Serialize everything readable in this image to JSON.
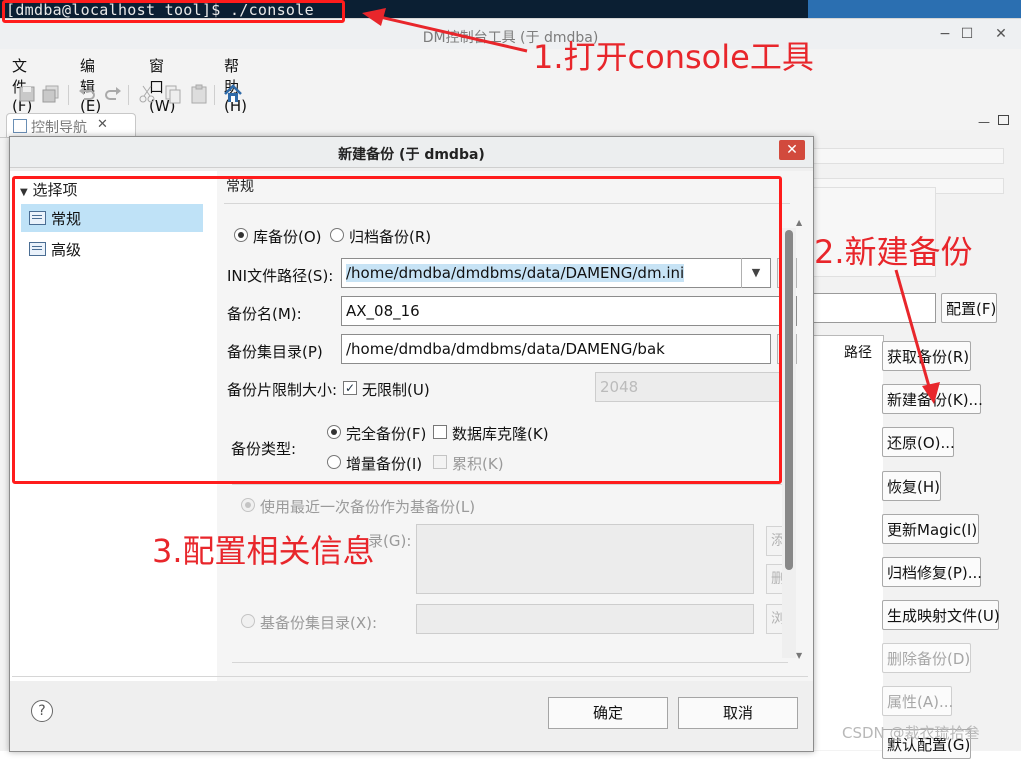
{
  "terminal": {
    "prompt": "[dmdba@localhost tool]$ ./console"
  },
  "window": {
    "title": "DM控制台工具 (于 dmdba)",
    "controls": {
      "minimize": "−",
      "maximize": "☐",
      "close": "✕"
    }
  },
  "menu": [
    "文件(F)",
    "编辑(E)",
    "窗口(W)",
    "帮助(H)"
  ],
  "toolbar_icons": [
    "save-icon",
    "save-all-icon",
    "undo-icon",
    "redo-icon",
    "cut-icon",
    "copy-icon",
    "paste-icon",
    "home-icon"
  ],
  "nav_tab": {
    "label": "控制导航",
    "close": "✕"
  },
  "right_panel": {
    "config_button": "配置(F)",
    "table_header": "路径",
    "buttons": [
      {
        "label": "获取备份(R)",
        "enabled": true
      },
      {
        "label": "新建备份(K)...",
        "enabled": true
      },
      {
        "label": "还原(O)...",
        "enabled": true
      },
      {
        "label": "恢复(H)",
        "enabled": true
      },
      {
        "label": "更新Magic(I)",
        "enabled": true
      },
      {
        "label": "归档修复(P)...",
        "enabled": true
      },
      {
        "label": "生成映射文件(U)",
        "enabled": true
      },
      {
        "label": "删除备份(D)",
        "enabled": false
      },
      {
        "label": "属性(A)...",
        "enabled": false
      },
      {
        "label": "默认配置(G)",
        "enabled": true
      }
    ]
  },
  "dialog": {
    "title": "新建备份 (于 dmdba)",
    "close": "✕",
    "options_header": "选择项",
    "options": [
      {
        "label": "常规",
        "selected": true
      },
      {
        "label": "高级",
        "selected": false
      }
    ],
    "group_label": "常规",
    "backup_kind": {
      "db_backup": "库备份(O)",
      "archive_backup": "归档备份(R)",
      "selected": "db_backup"
    },
    "ini_path": {
      "label": "INI文件路径(S):",
      "value": "/home/dmdba/dmdbms/data/DAMENG/dm.ini",
      "browse": "浏"
    },
    "backup_name": {
      "label": "备份名(M):",
      "value": "AX_08_16"
    },
    "backup_dir": {
      "label": "备份集目录(P)",
      "value": "/home/dmdba/dmdbms/data/DAMENG/bak",
      "browse": "浏"
    },
    "piece_limit": {
      "label": "备份片限制大小:",
      "unlimited_label": "无限制(U)",
      "unlimited": true,
      "value": "2048"
    },
    "backup_type": {
      "label": "备份类型:",
      "full": "完全备份(F)",
      "incremental": "增量备份(I)",
      "clone": "数据库克隆(K)",
      "cumulative": "累积(K)",
      "selected": "full"
    },
    "base_latest": "使用最近一次备份作为基备份(L)",
    "base_dir_label_partial": "录(G):",
    "add_button": "添加",
    "remove_button": "删除",
    "base_set_dir": "基备份集目录(X):",
    "browse_button": "浏览",
    "ok": "确定",
    "cancel": "取消",
    "help": "?"
  },
  "annotations": {
    "step1": "1.打开console工具",
    "step2": "2.新建备份",
    "step3": "3.配置相关信息",
    "color": "#e8262b"
  },
  "watermark": "CSDN @裁衣琉拾叁"
}
